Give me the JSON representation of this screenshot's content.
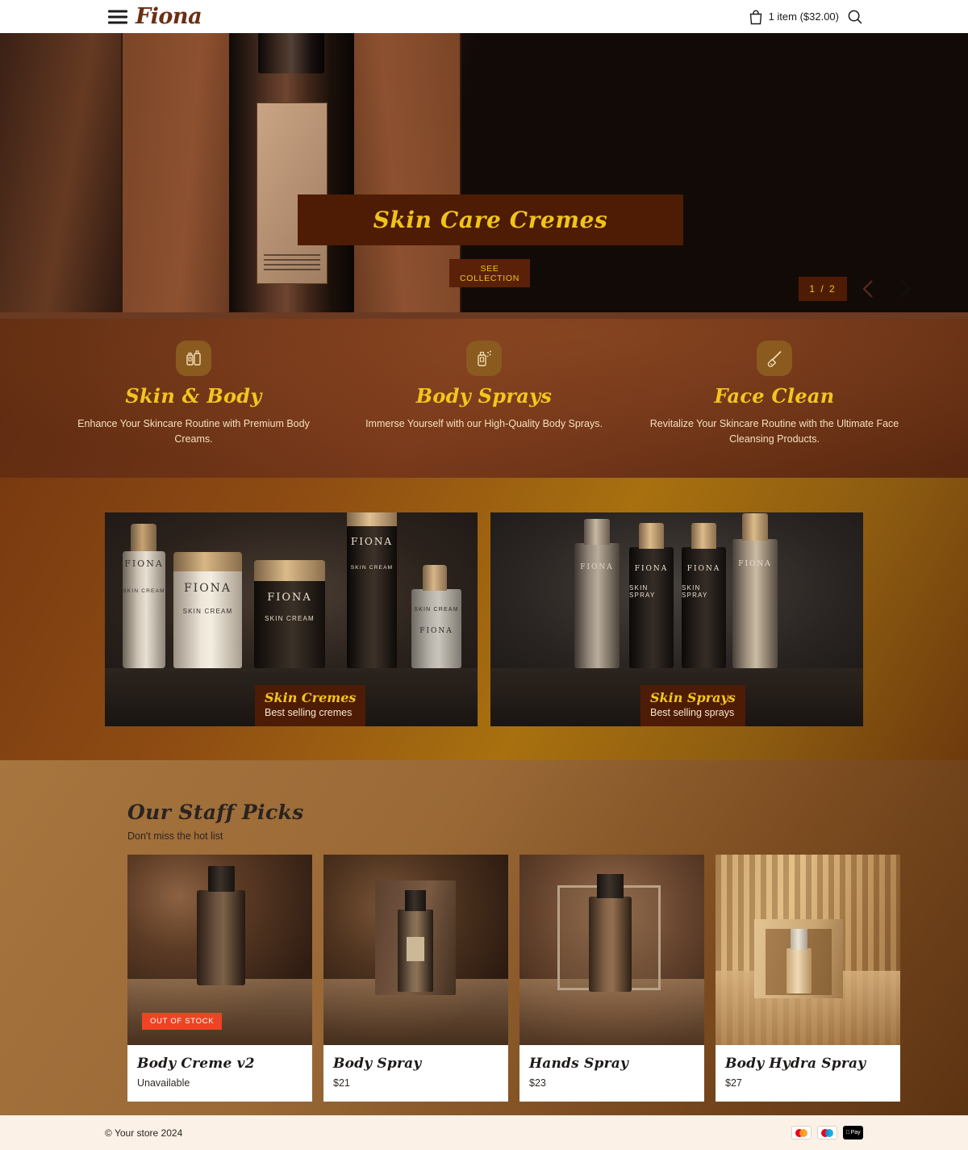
{
  "header": {
    "menu_icon": "hamburger-menu-icon",
    "logo": "Fiona",
    "cart_text": "1 item ($32.00)",
    "cart_icon": "shopping-bag-icon",
    "search_icon": "search-icon"
  },
  "hero": {
    "title": "Skin Care Cremes",
    "cta_label": "SEE COLLECTION",
    "counter": "1 / 2",
    "prev_icon": "chevron-left-icon",
    "next_icon": "chevron-right-icon",
    "band_color": "#4E1C05",
    "title_color": "#F0C419"
  },
  "features": [
    {
      "icon": "lotion-bottles-icon",
      "title": "Skin & Body",
      "desc": "Enhance Your Skincare Routine with Premium Body Creams."
    },
    {
      "icon": "spray-can-icon",
      "title": "Body Sprays",
      "desc": "Immerse Yourself with our High-Quality Body Sprays."
    },
    {
      "icon": "face-brush-icon",
      "title": "Face Clean",
      "desc": "Revitalize Your Skincare Routine with the Ultimate Face Cleansing Products."
    }
  ],
  "collections": [
    {
      "badge_title": "Skin Cremes",
      "badge_sub": "Best selling cremes",
      "brand": "FIONA",
      "product_label": "SKIN CREAM"
    },
    {
      "badge_title": "Skin Sprays",
      "badge_sub": "Best selling sprays",
      "brand": "FIONA",
      "product_label": "SKIN SPRAY"
    }
  ],
  "picks": {
    "title": "Our Staff Picks",
    "subtitle": "Don't miss the hot list",
    "products": [
      {
        "name": "Body Creme v2",
        "price": "Unavailable",
        "badge": "OUT OF STOCK",
        "scene": "prod-scene-1"
      },
      {
        "name": "Body Spray",
        "price": "$21",
        "badge": "",
        "scene": "prod-scene-2"
      },
      {
        "name": "Hands Spray",
        "price": "$23",
        "badge": "",
        "scene": "prod-scene-3"
      },
      {
        "name": "Body Hydra Spray",
        "price": "$27",
        "badge": "",
        "scene": "prod-scene-4"
      }
    ]
  },
  "footer": {
    "copyright": "© Your store 2024",
    "payments": [
      {
        "name": "mastercard-icon",
        "type": "circles",
        "c1": "#EB001B",
        "c2": "#F79E1B"
      },
      {
        "name": "maestro-icon",
        "type": "circles",
        "c1": "#EB001B",
        "c2": "#00A2E5"
      },
      {
        "name": "apple-pay-icon",
        "type": "applepay",
        "label": "Pay"
      }
    ]
  },
  "colors": {
    "accent_gold": "#F0C419",
    "dark_brown": "#4E1C05",
    "out_of_stock": "#EC4424"
  }
}
